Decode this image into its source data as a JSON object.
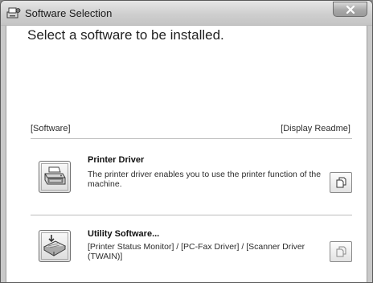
{
  "window": {
    "title": "Software Selection"
  },
  "main": {
    "heading": "Select a software to be installed.",
    "section_left": "[Software]",
    "section_right": "[Display Readme]"
  },
  "items": [
    {
      "title": "Printer Driver",
      "description": "The printer driver enables you to use the printer function of the machine.",
      "icon": "printer-icon",
      "readme_icon": "document-icon"
    },
    {
      "title": "Utility Software...",
      "description": "[Printer Status Monitor] / [PC-Fax Driver] / [Scanner Driver (TWAIN)]",
      "icon": "utility-software-icon",
      "readme_icon": "document-icon"
    }
  ],
  "colors": {
    "window_frame": "#c9c9c9",
    "content_bg": "#ffffff",
    "close_button": "#a8a8a8"
  }
}
